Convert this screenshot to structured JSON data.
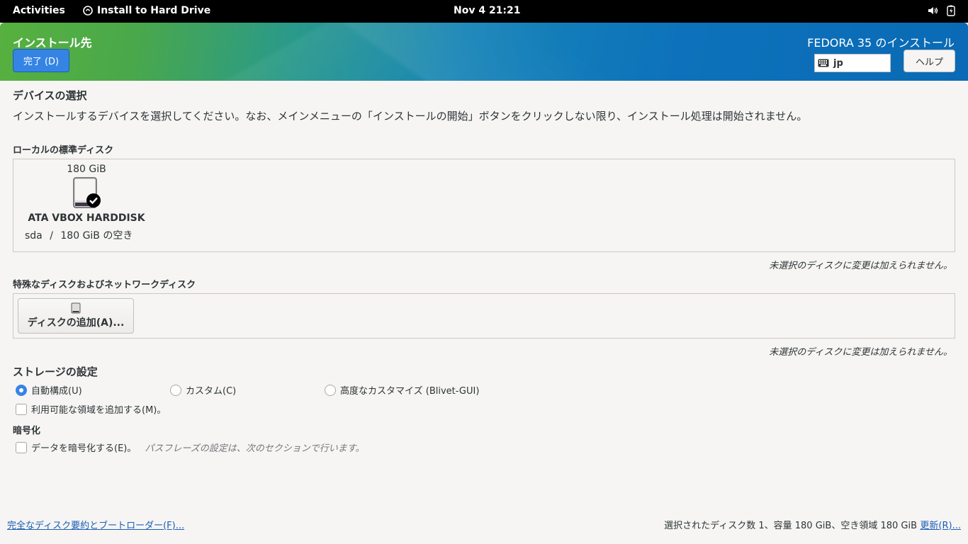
{
  "topbar": {
    "activities": "Activities",
    "app_name": "Install to Hard Drive",
    "clock": "Nov 4  21:21"
  },
  "header": {
    "title": "インストール先",
    "done_label": "完了 (D)",
    "product": "FEDORA 35 のインストール",
    "keyboard_layout": "jp",
    "help_label": "ヘルプ"
  },
  "device_selection": {
    "heading": "デバイスの選択",
    "description": "インストールするデバイスを選択してください。なお、メインメニューの「インストールの開始」ボタンをクリックしない限り、インストール処理は開始されません。"
  },
  "local_disks": {
    "heading": "ローカルの標準ディスク",
    "disks": [
      {
        "size": "180 GiB",
        "model": "ATA VBOX HARDDISK",
        "name": "sda",
        "separator": "/",
        "free": "180 GiB の空き",
        "selected": true
      }
    ],
    "note": "未選択のディスクに変更は加えられません。"
  },
  "special_disks": {
    "heading": "特殊なディスクおよびネットワークディスク",
    "add_label": "ディスクの追加(A)...",
    "note": "未選択のディスクに変更は加えられません。"
  },
  "storage_config": {
    "heading": "ストレージの設定",
    "options": [
      {
        "label": "自動構成(U)",
        "selected": true
      },
      {
        "label": "カスタム(C)",
        "selected": false
      },
      {
        "label": "高度なカスタマイズ (Blivet-GUI)",
        "selected": false
      }
    ],
    "reclaim_label": "利用可能な領域を追加する(M)。"
  },
  "encryption": {
    "heading": "暗号化",
    "encrypt_label": "データを暗号化する(E)。",
    "hint": "パスフレーズの設定は、次のセクションで行います。"
  },
  "footer": {
    "summary_link": "完全なディスク要約とブートローダー(F)...",
    "summary": "選択されたディスク数 1、容量 180 GiB、空き領域 180 GiB",
    "refresh_link": "更新(R)..."
  },
  "colors": {
    "accent": "#3584e4",
    "link": "#1a5fb4",
    "header_start": "#57b13f",
    "header_end": "#0a6ab5"
  }
}
